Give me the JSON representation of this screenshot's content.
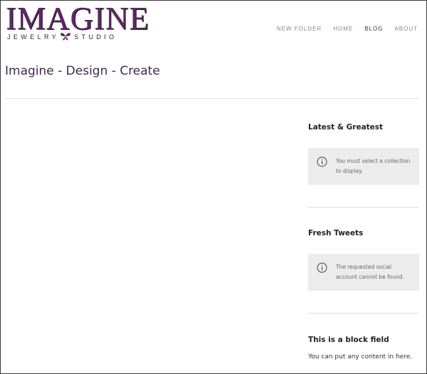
{
  "brand": {
    "logo_main": "IMAGINE",
    "logo_sub_left": "JEWELRY",
    "logo_sub_right": "STUDIO",
    "accent_color": "#5b2a63"
  },
  "nav": {
    "items": [
      {
        "label": "NEW FOLDER",
        "active": false
      },
      {
        "label": "HOME",
        "active": false
      },
      {
        "label": "BLOG",
        "active": true
      },
      {
        "label": "ABOUT",
        "active": false
      }
    ]
  },
  "page": {
    "title": "Imagine - Design - Create"
  },
  "sidebar": {
    "widgets": [
      {
        "title": "Latest & Greatest",
        "notice_icon": "info-icon",
        "notice_text": "You must select a collection to display."
      },
      {
        "title": "Fresh Tweets",
        "notice_icon": "info-icon",
        "notice_text": "The requested social account cannot be found."
      },
      {
        "title": "This is a block field",
        "body": "You can put any content in here."
      }
    ]
  }
}
